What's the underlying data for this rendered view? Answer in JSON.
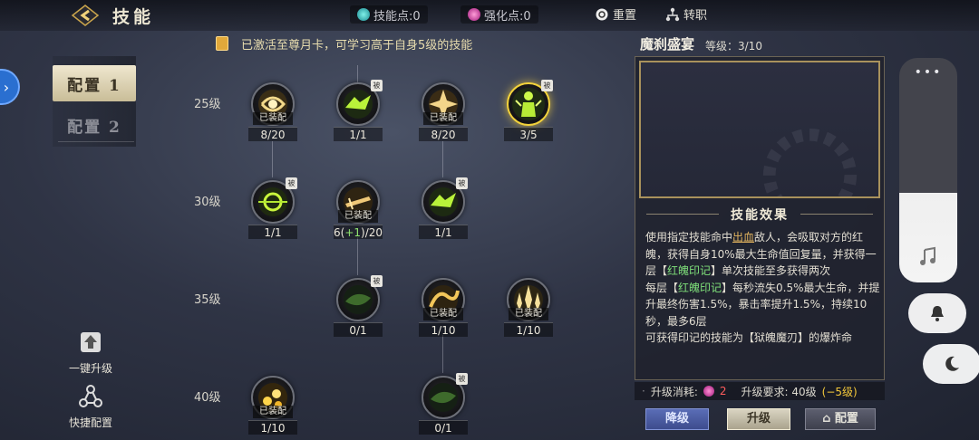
{
  "header": {
    "title": "技能",
    "skill_points": "技能点:0",
    "enhance_points": "强化点:0",
    "reset_label": "重置",
    "class_label": "转职"
  },
  "sidebar": {
    "config_tabs": [
      {
        "label": "配置 1",
        "active": true
      },
      {
        "label": "配置 2",
        "active": false
      }
    ],
    "one_key_upgrade": "一键升级",
    "quick_config": "快捷配置"
  },
  "notice": "已激活至尊月卡，可学习高于自身5级的技能",
  "tree": {
    "levels": [
      "25级",
      "30级",
      "35级",
      "40级"
    ],
    "skills": [
      {
        "row": 0,
        "col": 0,
        "count": "8/20",
        "equipped": "已装配",
        "passive": "",
        "style": "gold-wave"
      },
      {
        "row": 0,
        "col": 1,
        "count": "1/1",
        "equipped": "",
        "passive": "被",
        "style": "green-beast"
      },
      {
        "row": 0,
        "col": 2,
        "count": "8/20",
        "equipped": "已装配",
        "passive": "",
        "style": "gold-burst"
      },
      {
        "row": 0,
        "col": 3,
        "count": "3/5",
        "equipped": "",
        "passive": "被",
        "style": "green-figure",
        "selected": true
      },
      {
        "row": 1,
        "col": 0,
        "count": "1/1",
        "equipped": "",
        "passive": "被",
        "style": "green-orb"
      },
      {
        "row": 1,
        "col": 1,
        "count_base": "6(",
        "count_plus": "+1",
        "count_tail": ")/20",
        "equipped": "已装配",
        "passive": "",
        "style": "gold-dagger"
      },
      {
        "row": 1,
        "col": 2,
        "count": "1/1",
        "equipped": "",
        "passive": "被",
        "style": "green-beast"
      },
      {
        "row": 2,
        "col": 1,
        "count": "0/1",
        "equipped": "",
        "passive": "被",
        "style": "dark-green"
      },
      {
        "row": 2,
        "col": 2,
        "count": "1/10",
        "equipped": "已装配",
        "passive": "",
        "style": "gold-dragon"
      },
      {
        "row": 2,
        "col": 3,
        "count": "1/10",
        "equipped": "已装配",
        "passive": "",
        "style": "gold-crystal"
      },
      {
        "row": 3,
        "col": 0,
        "count": "1/10",
        "equipped": "已装配",
        "passive": "",
        "style": "gold-fire"
      },
      {
        "row": 3,
        "col": 2,
        "count": "0/1",
        "equipped": "",
        "passive": "被",
        "style": "dark-green"
      }
    ]
  },
  "detail": {
    "name": "魔刹盛宴",
    "level": "等级：3/10",
    "effect_title": "技能效果",
    "desc": {
      "p1_a": "使用指定技能命中",
      "p1_bleed": "出血",
      "p1_b": "敌人，会吸取对方的红魄，获得自身10%最大生命值回复量，并获得一层【",
      "p1_mark": "红魄印记",
      "p1_c": "】单次技能至多获得两次",
      "p2_a": "每层【",
      "p2_mark": "红魄印记",
      "p2_b": "】每秒流失0.5%最大生命，并提升最终伤害1.5%，暴击率提升1.5%，持续10秒，最多6层",
      "p3": "可获得印记的技能为【狱魄魔刃】的爆炸命"
    },
    "cost_label": "升级消耗:",
    "cost_value": "2",
    "req_label": "升级要求: 40级",
    "req_warn": "(−5级)",
    "btn_downgrade": "降级",
    "btn_upgrade": "升级",
    "btn_config": "配置"
  },
  "colors": {
    "gold": "#f3d23b",
    "highlight_green": "#7fe07a",
    "warn_red": "#ff5d5d",
    "downgrade_blue": "#3d4c8e"
  }
}
